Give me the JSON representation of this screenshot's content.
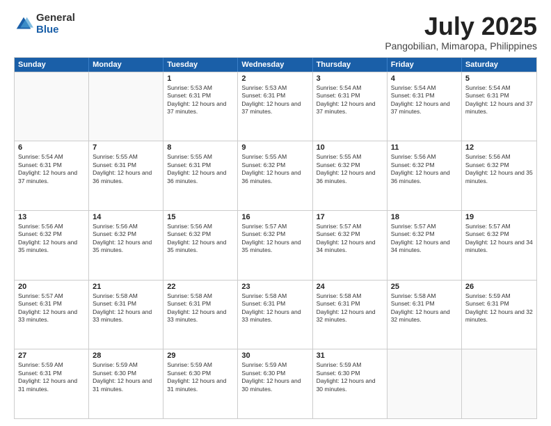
{
  "header": {
    "logo_general": "General",
    "logo_blue": "Blue",
    "title": "July 2025",
    "location": "Pangobilian, Mimaropa, Philippines"
  },
  "calendar": {
    "days_of_week": [
      "Sunday",
      "Monday",
      "Tuesday",
      "Wednesday",
      "Thursday",
      "Friday",
      "Saturday"
    ],
    "rows": [
      [
        {
          "day": "",
          "sunrise": "",
          "sunset": "",
          "daylight": "",
          "empty": true
        },
        {
          "day": "",
          "sunrise": "",
          "sunset": "",
          "daylight": "",
          "empty": true
        },
        {
          "day": "1",
          "sunrise": "Sunrise: 5:53 AM",
          "sunset": "Sunset: 6:31 PM",
          "daylight": "Daylight: 12 hours and 37 minutes."
        },
        {
          "day": "2",
          "sunrise": "Sunrise: 5:53 AM",
          "sunset": "Sunset: 6:31 PM",
          "daylight": "Daylight: 12 hours and 37 minutes."
        },
        {
          "day": "3",
          "sunrise": "Sunrise: 5:54 AM",
          "sunset": "Sunset: 6:31 PM",
          "daylight": "Daylight: 12 hours and 37 minutes."
        },
        {
          "day": "4",
          "sunrise": "Sunrise: 5:54 AM",
          "sunset": "Sunset: 6:31 PM",
          "daylight": "Daylight: 12 hours and 37 minutes."
        },
        {
          "day": "5",
          "sunrise": "Sunrise: 5:54 AM",
          "sunset": "Sunset: 6:31 PM",
          "daylight": "Daylight: 12 hours and 37 minutes."
        }
      ],
      [
        {
          "day": "6",
          "sunrise": "Sunrise: 5:54 AM",
          "sunset": "Sunset: 6:31 PM",
          "daylight": "Daylight: 12 hours and 37 minutes."
        },
        {
          "day": "7",
          "sunrise": "Sunrise: 5:55 AM",
          "sunset": "Sunset: 6:31 PM",
          "daylight": "Daylight: 12 hours and 36 minutes."
        },
        {
          "day": "8",
          "sunrise": "Sunrise: 5:55 AM",
          "sunset": "Sunset: 6:31 PM",
          "daylight": "Daylight: 12 hours and 36 minutes."
        },
        {
          "day": "9",
          "sunrise": "Sunrise: 5:55 AM",
          "sunset": "Sunset: 6:32 PM",
          "daylight": "Daylight: 12 hours and 36 minutes."
        },
        {
          "day": "10",
          "sunrise": "Sunrise: 5:55 AM",
          "sunset": "Sunset: 6:32 PM",
          "daylight": "Daylight: 12 hours and 36 minutes."
        },
        {
          "day": "11",
          "sunrise": "Sunrise: 5:56 AM",
          "sunset": "Sunset: 6:32 PM",
          "daylight": "Daylight: 12 hours and 36 minutes."
        },
        {
          "day": "12",
          "sunrise": "Sunrise: 5:56 AM",
          "sunset": "Sunset: 6:32 PM",
          "daylight": "Daylight: 12 hours and 35 minutes."
        }
      ],
      [
        {
          "day": "13",
          "sunrise": "Sunrise: 5:56 AM",
          "sunset": "Sunset: 6:32 PM",
          "daylight": "Daylight: 12 hours and 35 minutes."
        },
        {
          "day": "14",
          "sunrise": "Sunrise: 5:56 AM",
          "sunset": "Sunset: 6:32 PM",
          "daylight": "Daylight: 12 hours and 35 minutes."
        },
        {
          "day": "15",
          "sunrise": "Sunrise: 5:56 AM",
          "sunset": "Sunset: 6:32 PM",
          "daylight": "Daylight: 12 hours and 35 minutes."
        },
        {
          "day": "16",
          "sunrise": "Sunrise: 5:57 AM",
          "sunset": "Sunset: 6:32 PM",
          "daylight": "Daylight: 12 hours and 35 minutes."
        },
        {
          "day": "17",
          "sunrise": "Sunrise: 5:57 AM",
          "sunset": "Sunset: 6:32 PM",
          "daylight": "Daylight: 12 hours and 34 minutes."
        },
        {
          "day": "18",
          "sunrise": "Sunrise: 5:57 AM",
          "sunset": "Sunset: 6:32 PM",
          "daylight": "Daylight: 12 hours and 34 minutes."
        },
        {
          "day": "19",
          "sunrise": "Sunrise: 5:57 AM",
          "sunset": "Sunset: 6:32 PM",
          "daylight": "Daylight: 12 hours and 34 minutes."
        }
      ],
      [
        {
          "day": "20",
          "sunrise": "Sunrise: 5:57 AM",
          "sunset": "Sunset: 6:31 PM",
          "daylight": "Daylight: 12 hours and 33 minutes."
        },
        {
          "day": "21",
          "sunrise": "Sunrise: 5:58 AM",
          "sunset": "Sunset: 6:31 PM",
          "daylight": "Daylight: 12 hours and 33 minutes."
        },
        {
          "day": "22",
          "sunrise": "Sunrise: 5:58 AM",
          "sunset": "Sunset: 6:31 PM",
          "daylight": "Daylight: 12 hours and 33 minutes."
        },
        {
          "day": "23",
          "sunrise": "Sunrise: 5:58 AM",
          "sunset": "Sunset: 6:31 PM",
          "daylight": "Daylight: 12 hours and 33 minutes."
        },
        {
          "day": "24",
          "sunrise": "Sunrise: 5:58 AM",
          "sunset": "Sunset: 6:31 PM",
          "daylight": "Daylight: 12 hours and 32 minutes."
        },
        {
          "day": "25",
          "sunrise": "Sunrise: 5:58 AM",
          "sunset": "Sunset: 6:31 PM",
          "daylight": "Daylight: 12 hours and 32 minutes."
        },
        {
          "day": "26",
          "sunrise": "Sunrise: 5:59 AM",
          "sunset": "Sunset: 6:31 PM",
          "daylight": "Daylight: 12 hours and 32 minutes."
        }
      ],
      [
        {
          "day": "27",
          "sunrise": "Sunrise: 5:59 AM",
          "sunset": "Sunset: 6:31 PM",
          "daylight": "Daylight: 12 hours and 31 minutes."
        },
        {
          "day": "28",
          "sunrise": "Sunrise: 5:59 AM",
          "sunset": "Sunset: 6:30 PM",
          "daylight": "Daylight: 12 hours and 31 minutes."
        },
        {
          "day": "29",
          "sunrise": "Sunrise: 5:59 AM",
          "sunset": "Sunset: 6:30 PM",
          "daylight": "Daylight: 12 hours and 31 minutes."
        },
        {
          "day": "30",
          "sunrise": "Sunrise: 5:59 AM",
          "sunset": "Sunset: 6:30 PM",
          "daylight": "Daylight: 12 hours and 30 minutes."
        },
        {
          "day": "31",
          "sunrise": "Sunrise: 5:59 AM",
          "sunset": "Sunset: 6:30 PM",
          "daylight": "Daylight: 12 hours and 30 minutes."
        },
        {
          "day": "",
          "sunrise": "",
          "sunset": "",
          "daylight": "",
          "empty": true
        },
        {
          "day": "",
          "sunrise": "",
          "sunset": "",
          "daylight": "",
          "empty": true
        }
      ]
    ]
  }
}
